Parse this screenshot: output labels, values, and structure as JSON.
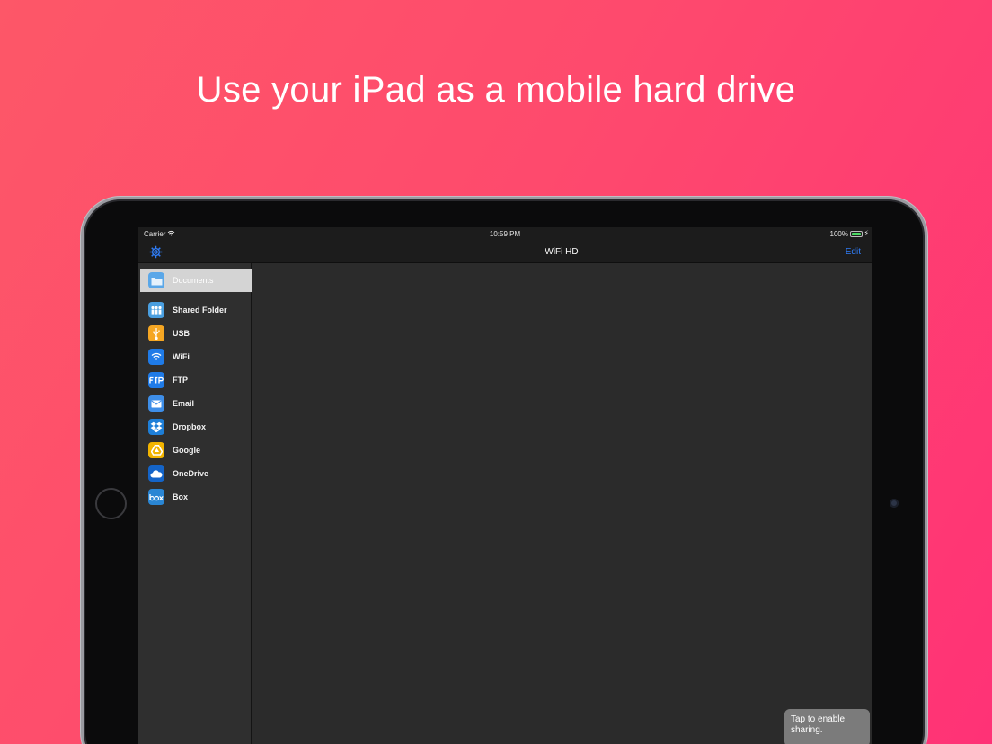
{
  "headline": "Use your iPad as a mobile hard drive",
  "status_bar": {
    "carrier": "Carrier",
    "time": "10:59 PM",
    "battery_percent": "100%",
    "battery_level": 1.0,
    "battery_color": "#4cd964"
  },
  "app": {
    "title": "WiFi HD",
    "edit_label": "Edit",
    "accent_color": "#2f7cf6"
  },
  "sidebar": {
    "settings_icon": "gear-icon",
    "items": [
      {
        "label": "Documents",
        "icon": "folder-icon",
        "color": "#5aa7e8",
        "selected": true
      },
      {
        "label": "Shared Folder",
        "icon": "people-icon",
        "color": "#4a9fe0"
      },
      {
        "label": "USB",
        "icon": "usb-icon",
        "color": "#f5a623"
      },
      {
        "label": "WiFi",
        "icon": "wifi-icon",
        "color": "#1f7be8"
      },
      {
        "label": "FTP",
        "icon": "ftp-icon",
        "color": "#1f7be8"
      },
      {
        "label": "Email",
        "icon": "envelope-icon",
        "color": "#3e8ee8"
      },
      {
        "label": "Dropbox",
        "icon": "dropbox-icon",
        "color": "#1e7fd8"
      },
      {
        "label": "Google",
        "icon": "google-drive-icon",
        "color": "#f2b400"
      },
      {
        "label": "OneDrive",
        "icon": "cloud-icon",
        "color": "#1464c8"
      },
      {
        "label": "Box",
        "icon": "box-icon",
        "color": "#2a86d4"
      }
    ]
  },
  "toast": {
    "text": "Tap to enable sharing."
  }
}
